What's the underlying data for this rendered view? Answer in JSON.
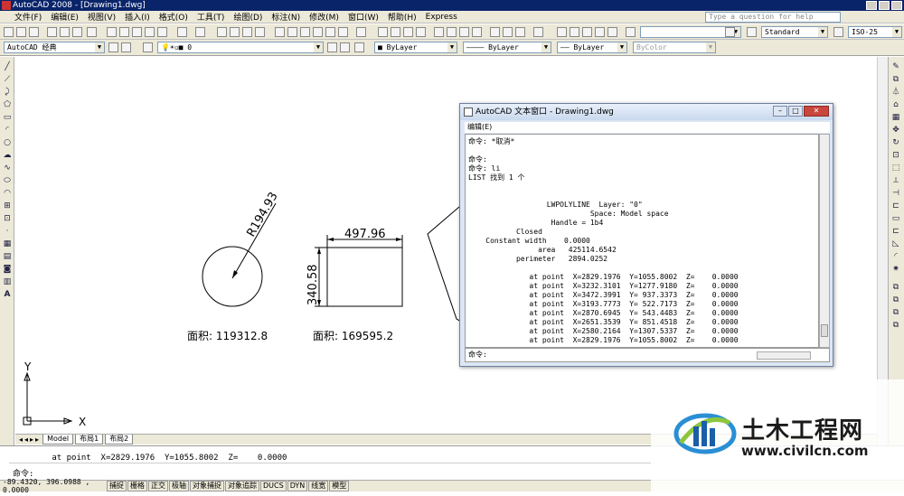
{
  "window": {
    "title": "AutoCAD 2008 - [Drawing1.dwg]"
  },
  "menu": [
    "文件(F)",
    "编辑(E)",
    "视图(V)",
    "插入(I)",
    "格式(O)",
    "工具(T)",
    "绘图(D)",
    "标注(N)",
    "修改(M)",
    "窗口(W)",
    "帮助(H)",
    "Express"
  ],
  "help_search": {
    "placeholder": "Type a question for help"
  },
  "toolbar": {
    "text_style": "Standard",
    "dim_style": "ISO-25",
    "workspace": "AutoCAD 经典",
    "layer": "0",
    "color": "ByLayer",
    "linetype": "ByLayer",
    "lineweight": "ByLayer",
    "plotstyle": "ByColor"
  },
  "drawing": {
    "circle_radius_label": "R194.93",
    "circle_area_label": "面积:  119312.8",
    "rect_width_label": "497.96",
    "rect_height_label": "340.58",
    "rect_area_label": "面积:  169595.2",
    "ucs_x": "X",
    "ucs_y": "Y"
  },
  "tabs": [
    "Model",
    "布局1",
    "布局2"
  ],
  "text_window": {
    "title": "AutoCAD 文本窗口 - Drawing1.dwg",
    "menu_label": "编辑(E)",
    "lines": [
      "命令: *取消*",
      "",
      "命令:",
      "命令: li",
      "LIST 找到 1 个",
      "",
      "",
      "                  LWPOLYLINE  Layer: \"0\"",
      "                            Space: Model space",
      "                   Handle = 1b4",
      "           Closed",
      "    Constant width    0.0000",
      "                area   425114.6542",
      "           perimeter   2894.0252",
      "",
      "              at point  X=2829.1976  Y=1055.8002  Z=    0.0000",
      "              at point  X=3232.3101  Y=1277.9180  Z=    0.0000",
      "              at point  X=3472.3991  Y= 937.3373  Z=    0.0000",
      "              at point  X=3193.7773  Y= 522.7173  Z=    0.0000",
      "              at point  X=2870.6945  Y= 543.4483  Z=    0.0000",
      "              at point  X=2651.3539  Y= 851.4518  Z=    0.0000",
      "              at point  X=2580.2164  Y=1307.5337  Z=    0.0000",
      "              at point  X=2829.1976  Y=1055.8002  Z=    0.0000"
    ],
    "prompt": "命令:"
  },
  "command_line": {
    "history": "        at point  X=2829.1976  Y=1055.8002  Z=    0.0000",
    "prompt": "命令:"
  },
  "status": {
    "coords": "-89.4320, 396.0988 , 0.0000",
    "buttons": [
      "捕捉",
      "栅格",
      "正交",
      "极轴",
      "对象捕捉",
      "对象追踪",
      "DUCS",
      "DYN",
      "线宽",
      "模型"
    ]
  },
  "watermark": {
    "title": "土木工程网",
    "url": "www.civilcn.com"
  }
}
